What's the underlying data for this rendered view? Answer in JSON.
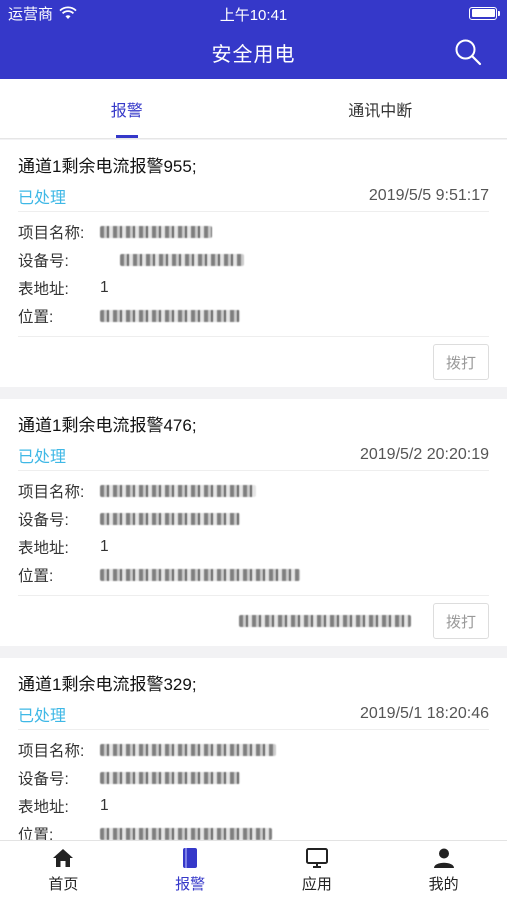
{
  "status": {
    "carrier": "运营商",
    "time": "上午10:41"
  },
  "navbar": {
    "title": "安全用电"
  },
  "tabs": [
    {
      "label": "报警",
      "active": true
    },
    {
      "label": "通讯中断",
      "active": false
    }
  ],
  "labels": {
    "project": "项目名称:",
    "device": "设备号:",
    "meter": "表地址:",
    "location": "位置:",
    "dial": "拨打"
  },
  "cards": [
    {
      "title": "通道1剩余电流报警955;",
      "state": "已处理",
      "time": "2019/5/5 9:51:17",
      "meter": "1"
    },
    {
      "title": "通道1剩余电流报警476;",
      "state": "已处理",
      "time": "2019/5/2 20:20:19",
      "meter": "1"
    },
    {
      "title": "通道1剩余电流报警329;",
      "state": "已处理",
      "time": "2019/5/1 18:20:46",
      "meter": "1"
    }
  ],
  "bottom_nav": [
    {
      "label": "首页",
      "icon": "home-icon"
    },
    {
      "label": "报警",
      "icon": "book-icon",
      "active": true
    },
    {
      "label": "应用",
      "icon": "monitor-icon"
    },
    {
      "label": "我的",
      "icon": "user-icon"
    }
  ],
  "colors": {
    "primary": "#3538c9",
    "processed": "#3fb8e6"
  }
}
